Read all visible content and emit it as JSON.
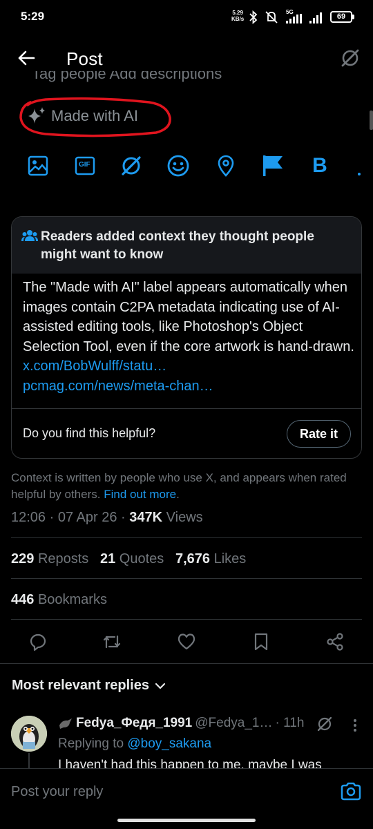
{
  "status_bar": {
    "time": "5:29",
    "net_speed_value": "5.29",
    "net_speed_unit": "KB/s",
    "network_type": "5G",
    "battery": "69"
  },
  "header": {
    "title": "Post"
  },
  "cut_off_text": "Tag people   Add descriptions",
  "made_with_ai_label": "Made with AI",
  "toolbar": {
    "icons": [
      "image-icon",
      "gif-icon",
      "grok-icon",
      "emoji-icon",
      "location-icon",
      "flag-icon",
      "bold-icon"
    ],
    "gif_label": "GIF",
    "bold_label": "B"
  },
  "community_note": {
    "header": "Readers added context they thought people might want to know",
    "body": "The \"Made with AI\" label appears automatically when images contain C2PA metadata indicating use of AI-assisted editing tools, like Photoshop's Object Selection Tool, even if the core artwork is hand-drawn.",
    "link1": "x.com/BobWulff/statu…",
    "link2": "pcmag.com/news/meta-chan…",
    "helpful_question": "Do you find this helpful?",
    "rate_button": "Rate it"
  },
  "context_info": {
    "text": "Context is written by people who use X, and appears when rated helpful by others.",
    "link": "Find out more",
    "period": "."
  },
  "post_meta": {
    "time": "12:06",
    "date": "07 Apr 26",
    "views_count": "347K",
    "views_label": "Views",
    "sep": "·"
  },
  "stats": {
    "reposts_count": "229",
    "reposts_label": "Reposts",
    "quotes_count": "21",
    "quotes_label": "Quotes",
    "likes_count": "7,676",
    "likes_label": "Likes",
    "bookmarks_count": "446",
    "bookmarks_label": "Bookmarks"
  },
  "actions": [
    "reply-icon",
    "repost-icon",
    "like-icon",
    "bookmark-icon",
    "share-icon"
  ],
  "replies_section": {
    "heading": "Most relevant replies"
  },
  "reply": {
    "display_name": "Fedya_Федя_1991",
    "handle": "@Fedya_1…",
    "time": "· 11h",
    "replying_to_label": "Replying to",
    "replying_to_handle": "@boy_sakana",
    "text": "I haven't had this happen to me, maybe I was"
  },
  "compose": {
    "placeholder": "Post your reply"
  },
  "colors": {
    "accent": "#1d9bf0",
    "background": "#000000",
    "annotation_red": "#e0141e"
  }
}
